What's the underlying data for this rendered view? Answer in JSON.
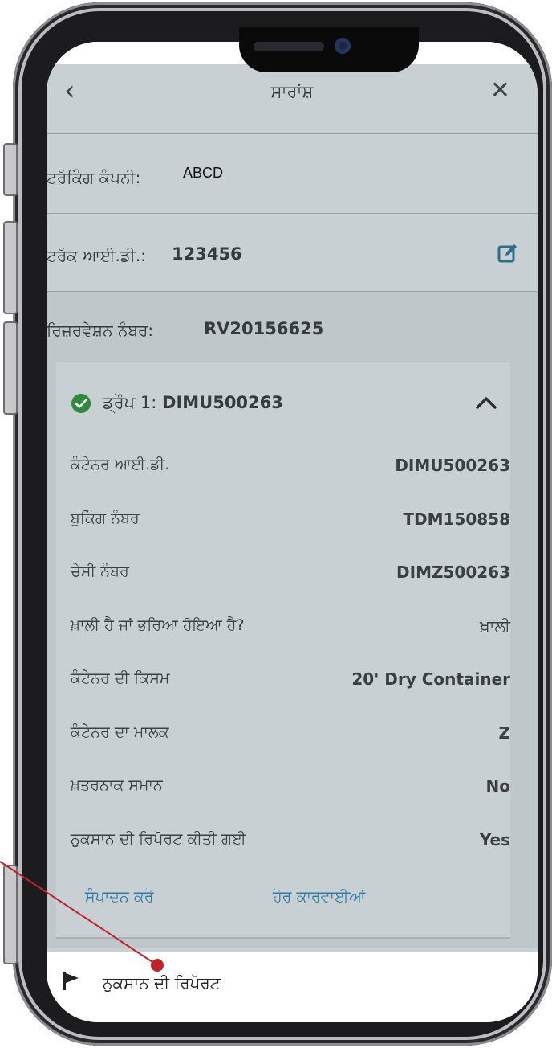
{
  "header": {
    "back_icon": "chevron-left-icon",
    "title": "ਸਾਰਾਂਸ਼",
    "close_icon": "close-icon"
  },
  "tracking": {
    "label": "ਟਰੱਕਿੰਗ ਕੰਪਨੀ:",
    "value": "ABCD"
  },
  "truck": {
    "label": "ਟਰੱਕ ਆਈ.ਡੀ.:",
    "value": "123456",
    "edit_icon": "edit-icon"
  },
  "reservation": {
    "label": "ਰਿਜ਼ਰਵੇਸ਼ਨ ਨੰਬਰ:",
    "value": "RV20156625"
  },
  "drop": {
    "status_icon": "check-circle-icon",
    "label": "ਡ੍ਰੌਪ 1:",
    "id": "DIMU500263",
    "toggle_icon": "chevron-up-icon",
    "fields": [
      {
        "key": "ਕੰਟੇਨਰ ਆਈ.ਡੀ.",
        "value": "DIMU500263"
      },
      {
        "key": "ਬੁਕਿੰਗ ਨੰਬਰ",
        "value": "TDM150858"
      },
      {
        "key": "ਚੇਸੀ ਨੰਬਰ",
        "value": "DIMZ500263"
      },
      {
        "key": "ਖ਼ਾਲੀ ਹੈ ਜਾਂ ਭਰਿਆ ਹੋਇਆ ਹੈ?",
        "value": "ਖ਼ਾਲੀ"
      },
      {
        "key": "ਕੰਟੇਨਰ ਦੀ ਕਿਸਮ",
        "value": "20' Dry Container"
      },
      {
        "key": "ਕੰਟੇਨਰ ਦਾ ਮਾਲਕ",
        "value": "Z"
      },
      {
        "key": "ਖ਼ਤਰਨਾਕ ਸਮਾਨ",
        "value": "No"
      },
      {
        "key": "ਨੁਕਸਾਨ ਦੀ ਰਿਪੋਰਟ ਕੀਤੀ ਗਈ",
        "value": "Yes"
      }
    ],
    "edit_action": "ਸੰਪਾਦਨ ਕਰੋ",
    "more_action": "ਹੋਰ ਕਾਰਵਾਈਆਂ"
  },
  "bottom_sheet": {
    "icon": "flag-icon",
    "label": "ਨੁਕਸਾਨ ਦੀ ਰਿਪੋਰਟ"
  },
  "colors": {
    "accent_green": "#2f8a3c",
    "link_blue": "#2e7fa8",
    "annotation_red": "#c0242b",
    "dim_overlay": "#c8d0d3"
  }
}
